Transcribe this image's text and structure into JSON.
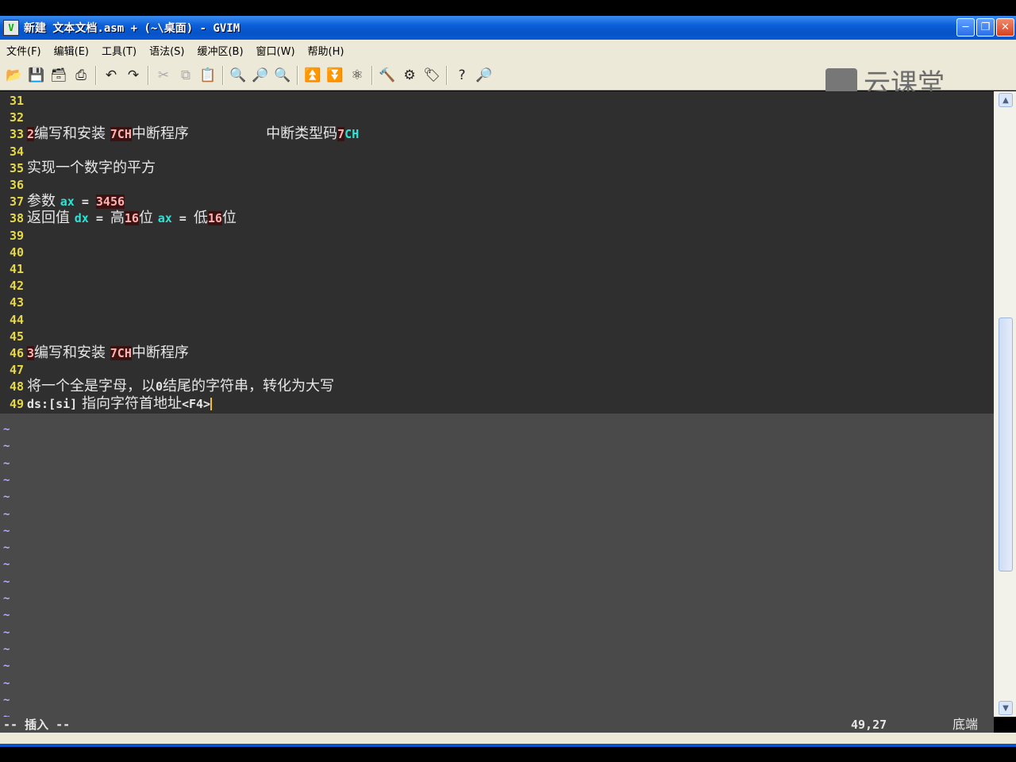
{
  "window": {
    "title": "新建 文本文档.asm + (~\\桌面) - GVIM",
    "app_icon": "vim-icon"
  },
  "menu": [
    {
      "label": "文件(F)"
    },
    {
      "label": "编辑(E)"
    },
    {
      "label": "工具(T)"
    },
    {
      "label": "语法(S)"
    },
    {
      "label": "缓冲区(B)"
    },
    {
      "label": "窗口(W)"
    },
    {
      "label": "帮助(H)"
    }
  ],
  "watermark": {
    "text": "云课堂"
  },
  "editor": {
    "lines": [
      {
        "n": "31",
        "segs": []
      },
      {
        "n": "32",
        "segs": []
      },
      {
        "n": "33",
        "segs": [
          {
            "t": "2",
            "c": "num"
          },
          {
            "t": "编写和安装 ",
            "c": ""
          },
          {
            "t": "7CH",
            "c": "num"
          },
          {
            "t": "中断程序                 中断类型码",
            "c": ""
          },
          {
            "t": "7",
            "c": "num"
          },
          {
            "t": "CH",
            "c": "kw"
          }
        ]
      },
      {
        "n": "34",
        "segs": []
      },
      {
        "n": "35",
        "segs": [
          {
            "t": "实现一个数字的平方",
            "c": ""
          }
        ]
      },
      {
        "n": "36",
        "segs": []
      },
      {
        "n": "37",
        "segs": [
          {
            "t": "参数 ",
            "c": ""
          },
          {
            "t": "ax",
            "c": "kw"
          },
          {
            "t": " = ",
            "c": "code"
          },
          {
            "t": "3456",
            "c": "num"
          }
        ]
      },
      {
        "n": "38",
        "segs": [
          {
            "t": "返回值 ",
            "c": ""
          },
          {
            "t": "dx",
            "c": "kw"
          },
          {
            "t": " = ",
            "c": "code"
          },
          {
            "t": "高",
            "c": ""
          },
          {
            "t": "16",
            "c": "num"
          },
          {
            "t": "位 ",
            "c": ""
          },
          {
            "t": "ax",
            "c": "kw"
          },
          {
            "t": " = ",
            "c": "code"
          },
          {
            "t": "低",
            "c": ""
          },
          {
            "t": "16",
            "c": "num"
          },
          {
            "t": "位",
            "c": ""
          }
        ]
      },
      {
        "n": "39",
        "segs": []
      },
      {
        "n": "40",
        "segs": []
      },
      {
        "n": "41",
        "segs": []
      },
      {
        "n": "42",
        "segs": []
      },
      {
        "n": "43",
        "segs": []
      },
      {
        "n": "44",
        "segs": []
      },
      {
        "n": "45",
        "segs": []
      },
      {
        "n": "46",
        "segs": [
          {
            "t": "3",
            "c": "num"
          },
          {
            "t": "编写和安装 ",
            "c": ""
          },
          {
            "t": "7CH",
            "c": "num"
          },
          {
            "t": "中断程序",
            "c": ""
          }
        ]
      },
      {
        "n": "47",
        "segs": []
      },
      {
        "n": "48",
        "segs": [
          {
            "t": "将一个全是字母，以",
            "c": ""
          },
          {
            "t": "0",
            "c": "code"
          },
          {
            "t": "结尾的字符串，转化为大写",
            "c": ""
          }
        ]
      },
      {
        "n": "49",
        "segs": [
          {
            "t": "ds:[si]",
            "c": "code"
          },
          {
            "t": " 指向字符首地址",
            "c": ""
          },
          {
            "t": "<F4>",
            "c": "code"
          }
        ]
      }
    ],
    "tilde_count": 18
  },
  "status": {
    "mode": "-- 插入 --",
    "position": "49,27",
    "percent": "底端"
  }
}
